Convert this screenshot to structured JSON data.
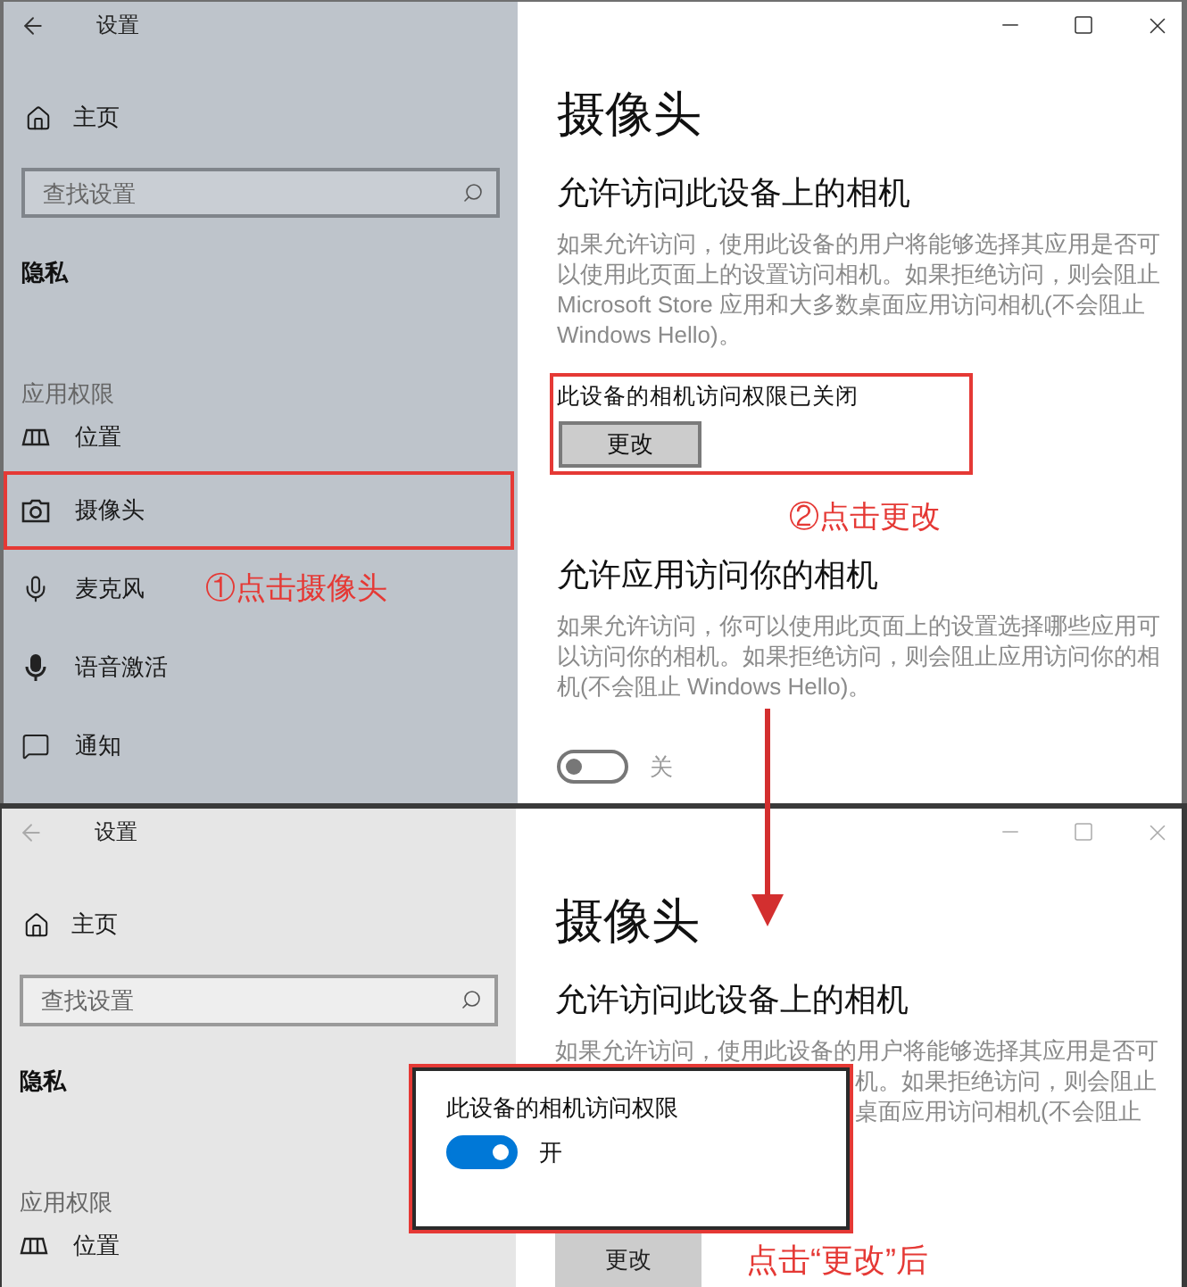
{
  "screens": [
    {
      "active": true,
      "window": {
        "title": "设置"
      },
      "sidebar": {
        "home": "主页",
        "search": {
          "placeholder": "查找设置"
        },
        "section": "隐私",
        "group": "应用权限",
        "items": [
          {
            "label": "位置",
            "marked": false
          },
          {
            "label": "摄像头",
            "marked": true
          },
          {
            "label": "麦克风",
            "marked": false,
            "callout": "①点击摄像头"
          },
          {
            "label": "语音激活",
            "marked": false
          },
          {
            "label": "通知",
            "marked": false
          }
        ]
      },
      "page": {
        "title": "摄像头",
        "heading": "允许访问此设备上的相机",
        "description": "如果允许访问，使用此设备的用户将能够选择其应用是否可以使用此页面上的设置访问相机。如果拒绝访问，则会阻止 Microsoft Store 应用和大多数桌面应用访问相机(不会阻止 Windows Hello)。",
        "device_access": {
          "status": "此设备的相机访问权限已关闭",
          "button": "更改",
          "marked": true
        },
        "callout": "②点击更改",
        "apps_heading": "允许应用访问你的相机",
        "apps_description": "如果允许访问，你可以使用此页面上的设置选择哪些应用可以访问你的相机。如果拒绝访问，则会阻止应用访问你的相机(不会阻止 Windows Hello)。",
        "apps_toggle": {
          "on": false,
          "label": "关"
        }
      }
    },
    {
      "active": false,
      "window": {
        "title": "设置"
      },
      "sidebar": {
        "home": "主页",
        "search": {
          "placeholder": "查找设置"
        },
        "section": "隐私",
        "group": "应用权限",
        "items": [
          {
            "label": "位置",
            "marked": false
          }
        ]
      },
      "page": {
        "title": "摄像头",
        "heading": "允许访问此设备上的相机",
        "description_lines": [
          "如果允许访问，使用此设备的用户将能够选择其应用是否可",
          "机。如果拒绝访问，则会阻止",
          "桌面应用访问相机(不会阻止"
        ],
        "device_access": {
          "button": "更改",
          "marked": false
        },
        "callout": "点击“更改”后",
        "flyout": {
          "label": "此设备的相机访问权限",
          "toggle": {
            "on": true,
            "label": "开"
          },
          "marked": true
        }
      }
    }
  ]
}
